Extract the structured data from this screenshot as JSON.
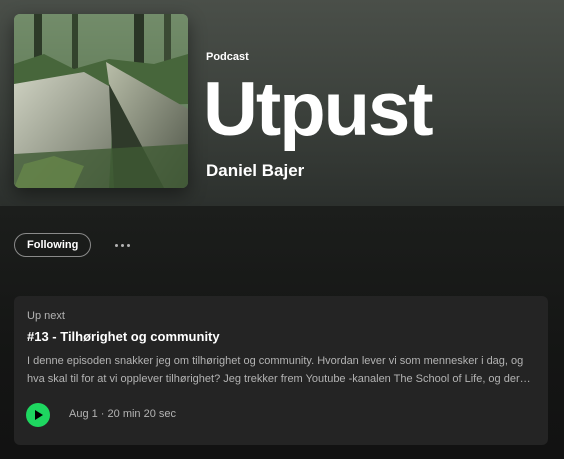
{
  "podcast": {
    "type_label": "Podcast",
    "title": "Utpust",
    "author": "Daniel Bajer"
  },
  "actions": {
    "follow_label": "Following",
    "more_icon": "more-horizontal-icon"
  },
  "up_next": {
    "label": "Up next",
    "episode_title": "#13 - Tilhørighet og community",
    "description": "I denne episoden snakker jeg om tilhørighet og community. Hvordan lever vi som mennesker i dag, og hva skal til for at vi opplever tilhørighet? Jeg trekker frem Youtube -kanalen The School of Life, og deres video…",
    "date": "Aug 1",
    "separator": " · ",
    "duration": "20 min 20 sec",
    "play_icon": "play-icon"
  },
  "colors": {
    "accent": "#1ed760",
    "background": "#121212",
    "card": "#242424",
    "secondary_text": "#b3b3b3"
  }
}
